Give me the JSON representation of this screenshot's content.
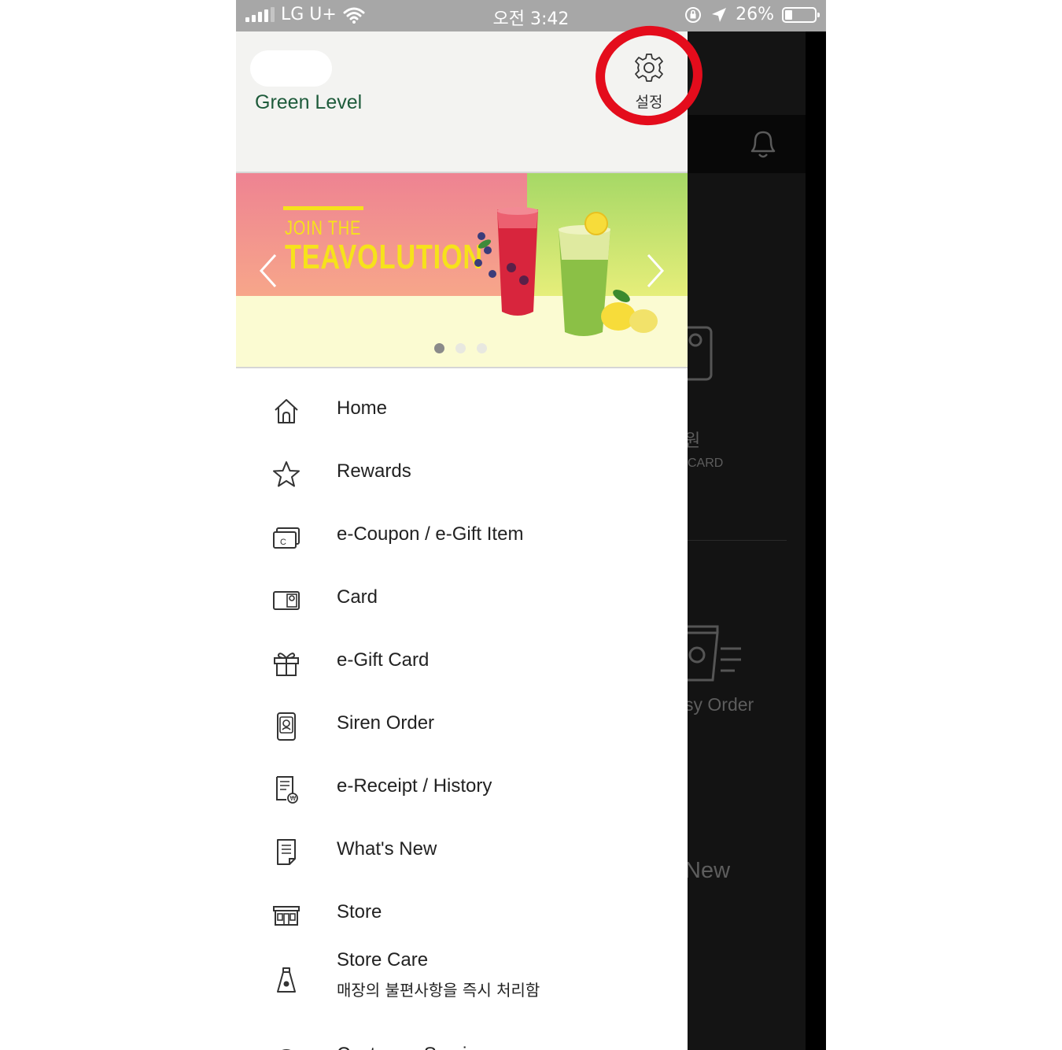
{
  "status_bar": {
    "carrier": "LG U+",
    "time": "오전 3:42",
    "battery": "26%"
  },
  "drawer": {
    "level": "Green Level",
    "settings_label": "설정",
    "banner": {
      "line1": "JOIN THE",
      "line2": "TEAVOLUTION",
      "slide_count": 3,
      "active_slide": 1
    },
    "menu": [
      {
        "label": "Home",
        "icon": "home-icon"
      },
      {
        "label": "Rewards",
        "icon": "star-icon"
      },
      {
        "label": "e-Coupon / e-Gift Item",
        "icon": "coupon-icon"
      },
      {
        "label": "Card",
        "icon": "card-icon"
      },
      {
        "label": "e-Gift Card",
        "icon": "gift-icon"
      },
      {
        "label": "Siren Order",
        "icon": "siren-order-icon"
      },
      {
        "label": "e-Receipt / History",
        "icon": "receipt-icon"
      },
      {
        "label": "What's New",
        "icon": "news-icon"
      },
      {
        "label": "Store",
        "icon": "store-icon"
      },
      {
        "label": "Store Care",
        "sub": "매장의 불편사항을 즉시 처리함",
        "icon": "store-care-icon"
      },
      {
        "label": "Customer Service",
        "icon": "help-icon"
      }
    ]
  },
  "background_app": {
    "won_fragment": "원",
    "card_fragment": "CARD",
    "order_fragment": "sy Order",
    "new_fragment": "New"
  },
  "colors": {
    "level_green": "#1e5b3b",
    "annotation_red": "#e40c1c",
    "statusbar_gray": "#a7a7a7"
  }
}
